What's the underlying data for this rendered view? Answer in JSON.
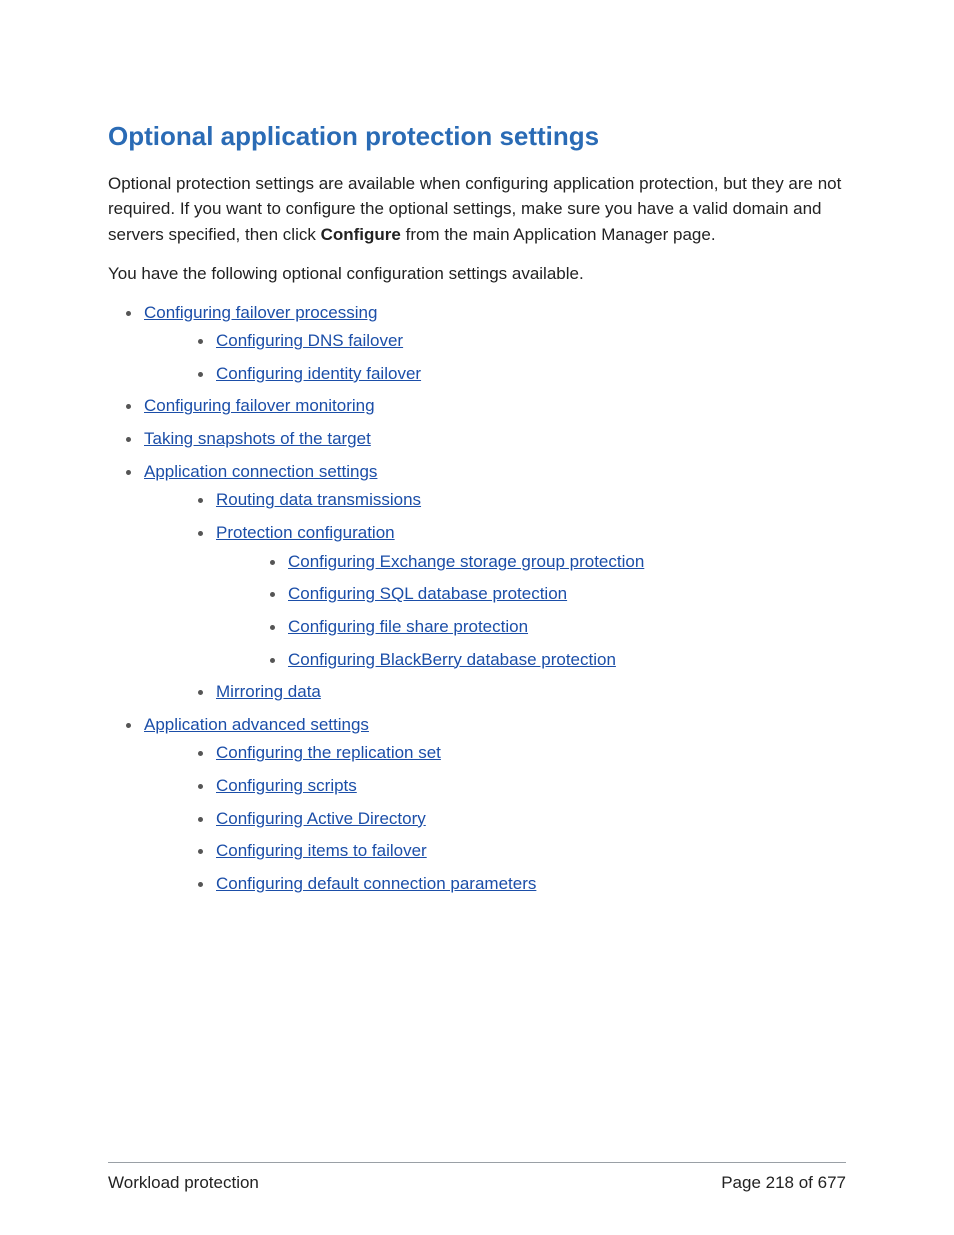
{
  "heading": "Optional application protection settings",
  "intro": {
    "pre": "Optional protection settings are available when configuring application protection, but they are not required. If you want to configure the optional settings, make sure you have a valid domain and servers specified, then click ",
    "bold": "Configure",
    "post": " from the main Application Manager page."
  },
  "lead": "You have the following optional configuration settings available.",
  "links": {
    "failover_processing": "Configuring failover processing",
    "dns_failover": "Configuring DNS failover",
    "identity_failover": "Configuring identity failover",
    "failover_monitoring": "Configuring failover monitoring",
    "snapshots": "Taking snapshots of the target",
    "app_conn": "Application connection settings",
    "routing": "Routing data transmissions",
    "protection_config": "Protection configuration",
    "exchange": "Configuring Exchange storage group protection",
    "sql": "Configuring SQL database protection",
    "fileshare": "Configuring file share protection",
    "blackberry": "Configuring BlackBerry database protection",
    "mirroring": "Mirroring data",
    "app_adv": "Application advanced settings",
    "replication_set": "Configuring the replication set",
    "scripts": "Configuring scripts",
    "ad": "Configuring Active Directory",
    "items_failover": "Configuring items to failover",
    "default_conn": "Configuring default connection parameters"
  },
  "footer": {
    "left": "Workload protection",
    "right": "Page 218 of 677"
  }
}
